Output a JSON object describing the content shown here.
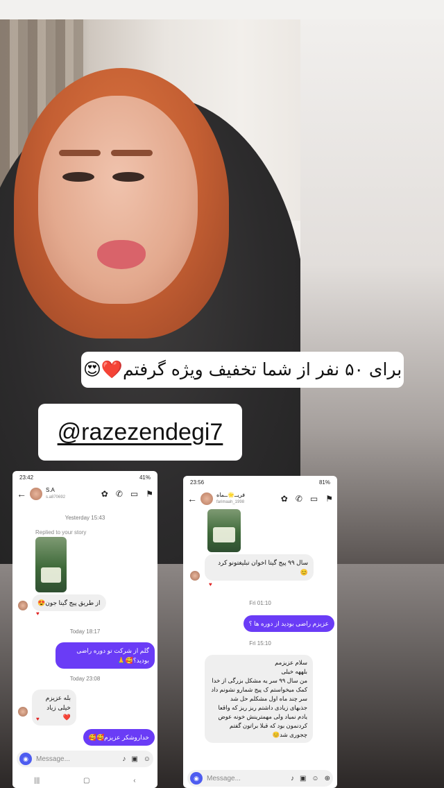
{
  "story": {
    "discount_text": "برای ۵۰ نفر از شما تخفیف ویژه گرفتم❤️😍",
    "mention": "@razezendegi7"
  },
  "left_chat": {
    "status_time": "23:42",
    "status_battery": "41%",
    "contact_name": "S.A",
    "contact_handle": "s.a870692",
    "timestamp_1": "Yesterday 15:43",
    "replied_label": "Replied to your story",
    "msg_1": "از طریق پیج گیتا جون😍",
    "timestamp_2": "Today 18:17",
    "msg_2": "گلم از شرکت تو دوره راضی بودید؟🥰🙏",
    "timestamp_3": "Today 23:08",
    "msg_3": "بله عزیزم خیلی زیاد ❤️",
    "msg_4": "خداروشکر عزیزم🥰🥰",
    "composer_placeholder": "Message..."
  },
  "right_chat": {
    "status_time": "23:56",
    "status_battery": "81%",
    "contact_name": "فریــ🌟ــماه",
    "contact_handle": "farimaah_1998",
    "msg_1": "سال ۹۹ پیج گیتا اخوان تبلیغتونو کرد 😊",
    "timestamp_1": "Fri 01:10",
    "msg_2": "عزیزم راضی بودید از دوره ها ؟",
    "timestamp_2": "Fri 15:10",
    "msg_3": "سلام عزیزمم\nبلههه خیلی\nمن سال ۹۹ سر یه مشکل بزرگی از خدا کمک میخواستم ک پیج شمارو نشونم داد سر چند ماه اول مشکلم حل شد\nجذبهای زیادی داشتم ریز ریز که واقعا یادم نمیاد ولی مهمترینش خونه عوض کردنمون بود که قبلا براتون گفتم چجوری شد😊",
    "composer_placeholder": "Message..."
  }
}
